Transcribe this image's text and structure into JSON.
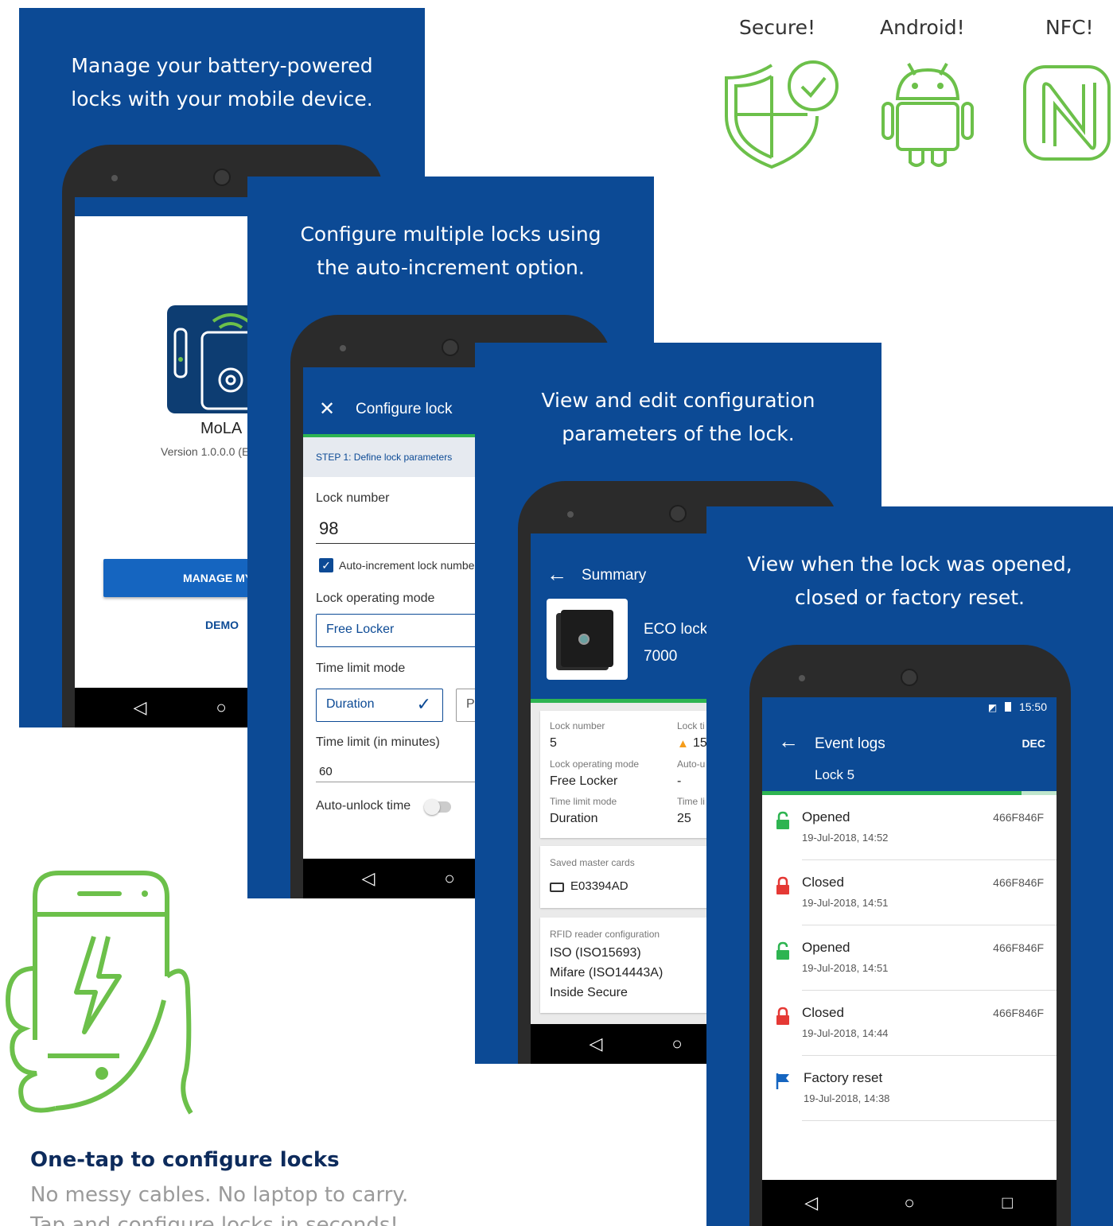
{
  "features": [
    {
      "label": "Secure!",
      "icon": "shield-check-icon"
    },
    {
      "label": "Android!",
      "icon": "android-icon"
    },
    {
      "label": "NFC!",
      "icon": "nfc-icon"
    }
  ],
  "card1": {
    "headline_line1": "Manage your battery-powered",
    "headline_line2": "locks with your mobile device.",
    "app_name": "MoLA",
    "version": "Version 1.0.0.0 (E",
    "button": "MANAGE MY S",
    "demo": "DEMO"
  },
  "card2": {
    "headline_line1": "Configure multiple locks using",
    "headline_line2": "the auto-increment option.",
    "title": "Configure lock",
    "step": "STEP 1: Define lock parameters",
    "lock_number_label": "Lock number",
    "lock_number_value": "98",
    "auto_increment_label": "Auto-increment lock numbe",
    "operating_mode_label": "Lock operating mode",
    "operating_mode_value": "Free Locker",
    "time_limit_mode_label": "Time limit mode",
    "time_limit_mode_value": "Duration",
    "time_limit_mode_other": "P",
    "time_limit_label": "Time limit (in minutes)",
    "time_limit_value": "60",
    "auto_unlock_label": "Auto-unlock time"
  },
  "card3": {
    "headline_line1": "View and edit configuration",
    "headline_line2": "parameters of the lock.",
    "title": "Summary",
    "product_line1": "ECO lock",
    "product_line2": "7000",
    "lock_number_label": "Lock number",
    "lock_number_value": "5",
    "lock_time_label": "Lock ti",
    "lock_time_value": "15",
    "operating_mode_label": "Lock operating mode",
    "operating_mode_value": "Free Locker",
    "auto_label": "Auto-u",
    "auto_value": "-",
    "time_limit_mode_label": "Time limit mode",
    "time_limit_mode_value": "Duration",
    "time_li_label": "Time li",
    "time_li_value": "25",
    "master_cards_label": "Saved master cards",
    "master_card_value": "E03394AD",
    "rfid_label": "RFID reader configuration",
    "rfid_line1": "ISO (ISO15693)",
    "rfid_line2": "Mifare (ISO14443A)",
    "rfid_line3": "Inside Secure"
  },
  "card4": {
    "headline_line1": "View when the lock was opened,",
    "headline_line2": "closed or factory reset.",
    "clock": "15:50",
    "title": "Event logs",
    "subtitle": "Lock 5",
    "action": "DEC",
    "events": [
      {
        "title": "Opened",
        "date": "19-Jul-2018, 14:52",
        "id": "466F846F",
        "icon": "unlock-icon",
        "color": "#2eb451"
      },
      {
        "title": "Closed",
        "date": "19-Jul-2018, 14:51",
        "id": "466F846F",
        "icon": "lock-icon",
        "color": "#e53935"
      },
      {
        "title": "Opened",
        "date": "19-Jul-2018, 14:51",
        "id": "466F846F",
        "icon": "unlock-icon",
        "color": "#2eb451"
      },
      {
        "title": "Closed",
        "date": "19-Jul-2018, 14:44",
        "id": "466F846F",
        "icon": "lock-icon",
        "color": "#e53935"
      },
      {
        "title": "Factory reset",
        "date": "19-Jul-2018, 14:38",
        "id": "",
        "icon": "flag-icon",
        "color": "#1565c0"
      }
    ]
  },
  "bottom": {
    "title": "One-tap to configure locks",
    "line1": "No messy cables. No laptop to carry.",
    "line2": "Tap and configure locks in seconds!"
  },
  "colors": {
    "brand_blue": "#0c4a95",
    "accent_green": "#2eb451",
    "icon_green": "#6cc04a"
  }
}
